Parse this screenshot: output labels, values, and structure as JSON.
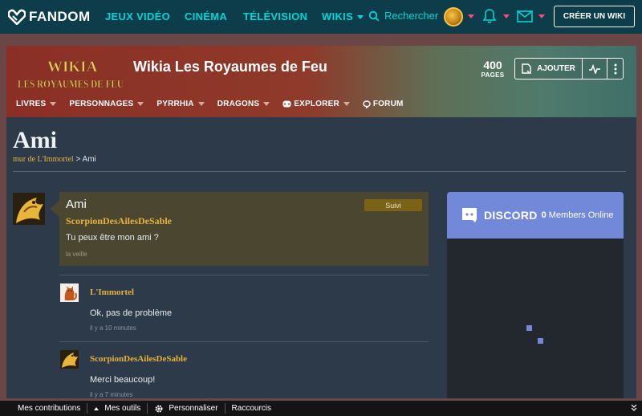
{
  "global_nav": {
    "logo_text": "FANDOM",
    "links": [
      "JEUX VIDÉO",
      "CINÉMA",
      "TÉLÉVISION",
      "WIKIS"
    ],
    "search_label": "Rechercher",
    "create_wiki": "CRÉER UN WIKI"
  },
  "wiki_header": {
    "logo_top": "WIKIA",
    "logo_bottom": "LES ROYAUMES DE FEU",
    "title": "Wikia Les Royaumes de Feu",
    "pages_count": "400",
    "pages_label": "PAGES",
    "add_label": "AJOUTER",
    "nav": [
      {
        "label": "LIVRES",
        "chevron": true
      },
      {
        "label": "PERSONNAGES",
        "chevron": true
      },
      {
        "label": "PYRRHIA",
        "chevron": true
      },
      {
        "label": "DRAGONS",
        "chevron": true
      },
      {
        "label": "EXPLORER",
        "chevron": true,
        "icon": "gamepad-icon"
      },
      {
        "label": "FORUM",
        "chevron": false,
        "icon": "speech-bubble-icon"
      }
    ]
  },
  "page": {
    "title": "Ami",
    "breadcrumb_link": "mur de L'Immortel",
    "breadcrumb_sep": ">",
    "breadcrumb_current": "Ami"
  },
  "thread": {
    "title": "Ami",
    "follow_label": "Suivi",
    "author": "ScorpionDesAilesDeSable",
    "text": "Tu peux être mon ami ?",
    "time": "la veille",
    "replies": [
      {
        "author": "L'Immortel",
        "text": "Ok, pas de problème",
        "time": "il y a 10 minutes",
        "avatar": "cat-avatar"
      },
      {
        "author": "ScorpionDesAilesDeSable",
        "text": "Merci beaucoup!",
        "time": "il y a 7 minutes",
        "avatar": "dragon-avatar"
      }
    ]
  },
  "discord": {
    "brand": "DISCORD",
    "count": "0",
    "members_label": "Members Online"
  },
  "toolbar": {
    "contributions": "Mes contributions",
    "tools": "Mes outils",
    "customize": "Personnaliser",
    "shortcuts": "Raccourcis"
  },
  "colors": {
    "nav_bg": "#0d3c4a",
    "nav_accent": "#00d6d6",
    "notify_pink": "#ff4b7a",
    "content_bg": "#2c3a4a",
    "username_gold": "#e8b23b",
    "discord_blurple": "#7289da"
  }
}
